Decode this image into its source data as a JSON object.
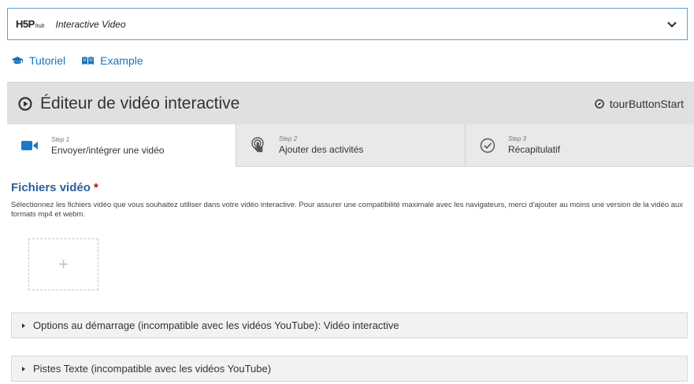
{
  "selector": {
    "logo_text": "H5P",
    "logo_sub": "hub",
    "title": "Interactive Video"
  },
  "links": [
    {
      "label": "Tutoriel",
      "icon": "graduation-cap-icon"
    },
    {
      "label": "Example",
      "icon": "book-icon"
    }
  ],
  "editor": {
    "title": "Éditeur de vidéo interactive",
    "tour_button": "tourButtonStart",
    "steps": [
      {
        "num": "Step 1",
        "label": "Envoyer/intégrer une vidéo",
        "icon": "video-camera-icon"
      },
      {
        "num": "Step 2",
        "label": "Ajouter des activités",
        "icon": "tap-icon"
      },
      {
        "num": "Step 3",
        "label": "Récapitulatif",
        "icon": "check-circle-icon"
      }
    ]
  },
  "video_files": {
    "title": "Fichiers vidéo",
    "required_marker": "*",
    "description": "Sélectionnez les fichiers vidéo que vous souhaitez utiliser dans votre vidéo interactive. Pour assurer une compatibilité maximale avec les navigateurs, merci d'ajouter au moins une version de la vidéo aux formats mp4 et webm.",
    "add_symbol": "+"
  },
  "sections": [
    {
      "label": "Options au démarrage (incompatible avec les vidéos YouTube): Vidéo interactive"
    },
    {
      "label": "Pistes Texte (incompatible avec les vidéos YouTube)"
    }
  ],
  "colors": {
    "link": "#1a73b9",
    "field_title": "#2c6099",
    "selector_border": "#5f9ed5",
    "video_icon": "#1a7ac8"
  }
}
